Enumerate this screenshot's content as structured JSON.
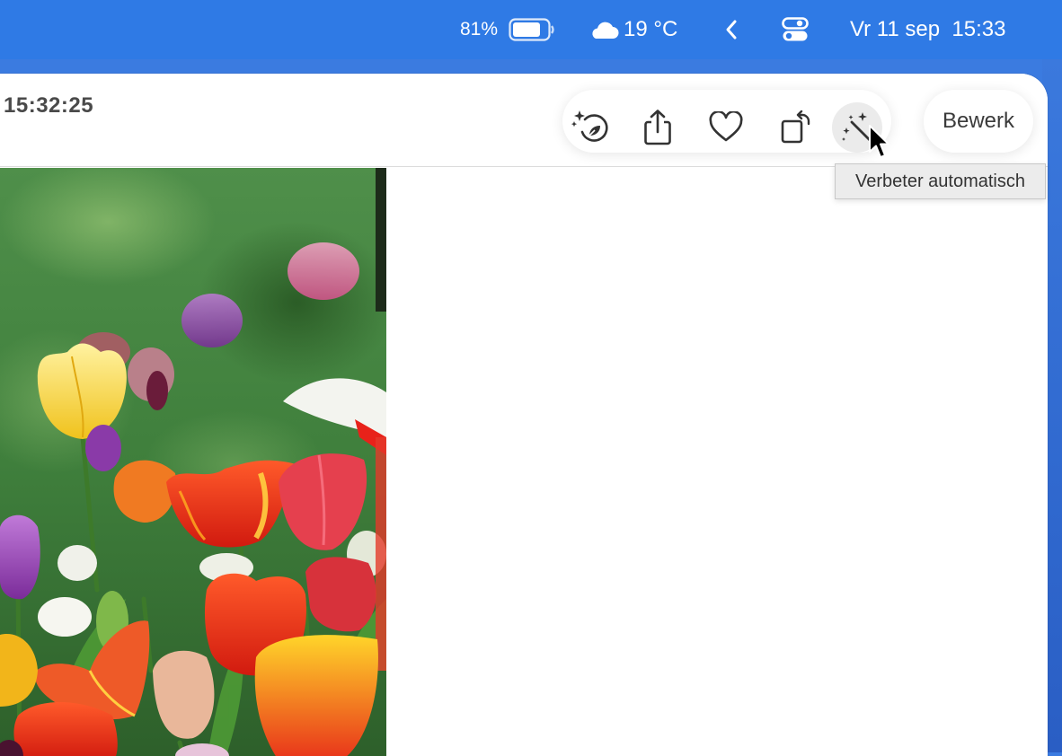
{
  "menubar": {
    "battery_percent": "81%",
    "weather_temp": "19 °C",
    "clock": "Vr 11 sep  15:33",
    "icons": {
      "battery": "battery-icon",
      "weather": "cloud-icon",
      "back": "chevron-left-icon",
      "control_center": "control-center-icon"
    }
  },
  "window": {
    "photo_time": "15:32:25",
    "toolbar": {
      "buttons": [
        {
          "id": "memories",
          "icon": "memories-sparkle-icon"
        },
        {
          "id": "share",
          "icon": "share-icon"
        },
        {
          "id": "favorite",
          "icon": "heart-icon"
        },
        {
          "id": "rotate",
          "icon": "rotate-icon"
        },
        {
          "id": "auto_enhance",
          "icon": "magic-wand-icon",
          "state": "hover"
        }
      ],
      "edit_label": "Bewerk"
    },
    "tooltip": "Verbeter automatisch"
  },
  "colors": {
    "menubar": "#2f7ae5",
    "window_bg": "#ffffff",
    "toolbar_text": "#4a4a4a",
    "hover_bg": "#ebebeb",
    "tooltip_bg": "#ececec"
  }
}
